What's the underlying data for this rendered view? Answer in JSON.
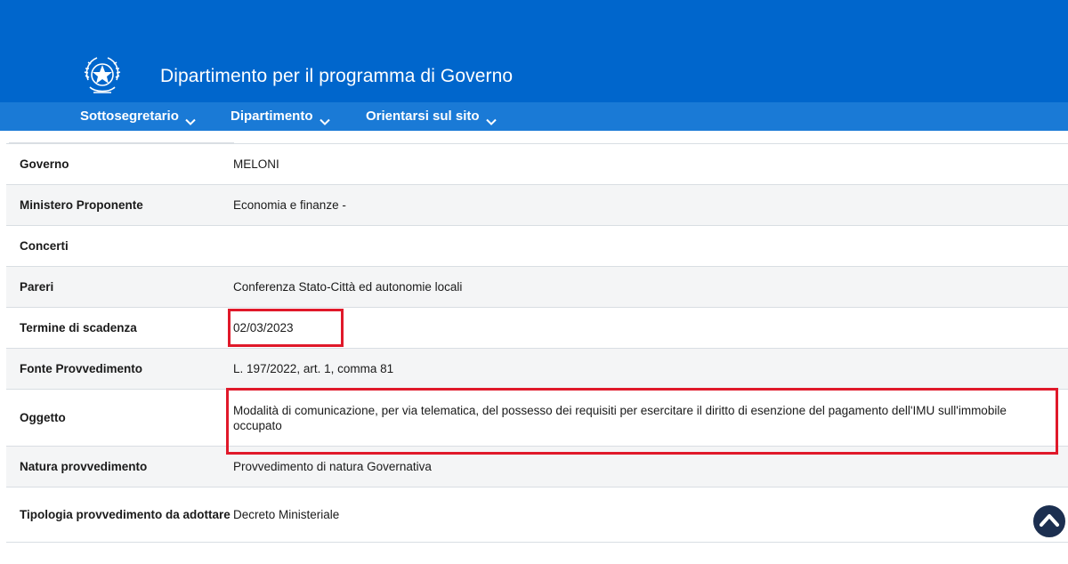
{
  "header": {
    "site_title": "Dipartimento per il programma di Governo"
  },
  "nav": {
    "items": [
      {
        "label": "Sottosegretario"
      },
      {
        "label": "Dipartimento"
      },
      {
        "label": "Orientarsi sul sito"
      }
    ]
  },
  "details": {
    "rows": [
      {
        "label": "Governo",
        "value": "MELONI"
      },
      {
        "label": "Ministero Proponente",
        "value": "Economia e finanze -"
      },
      {
        "label": "Concerti",
        "value": ""
      },
      {
        "label": "Pareri",
        "value": "Conferenza Stato-Città ed autonomie locali"
      },
      {
        "label": "Termine di scadenza",
        "value": "02/03/2023"
      },
      {
        "label": "Fonte Provvedimento",
        "value": "L. 197/2022, art. 1, comma 81"
      },
      {
        "label": "Oggetto",
        "value": "Modalità di comunicazione, per via telematica, del possesso dei requisiti per esercitare il diritto di esenzione del pagamento dell'IMU sull'immobile occupato"
      },
      {
        "label": "Natura provvedimento",
        "value": "Provvedimento di natura Governativa"
      },
      {
        "label": "Tipologia provvedimento da adottare",
        "value": "Decreto Ministeriale"
      }
    ]
  },
  "colors": {
    "header_bg": "#0066cc",
    "nav_bg": "#1a7ad6",
    "highlight": "#e0192a",
    "scroll_button": "#1c2f50"
  },
  "icons": {
    "emblem": "italian-republic-emblem-icon",
    "nav_chevron": "chevron-down-icon",
    "scroll_top": "chevron-up-icon"
  }
}
